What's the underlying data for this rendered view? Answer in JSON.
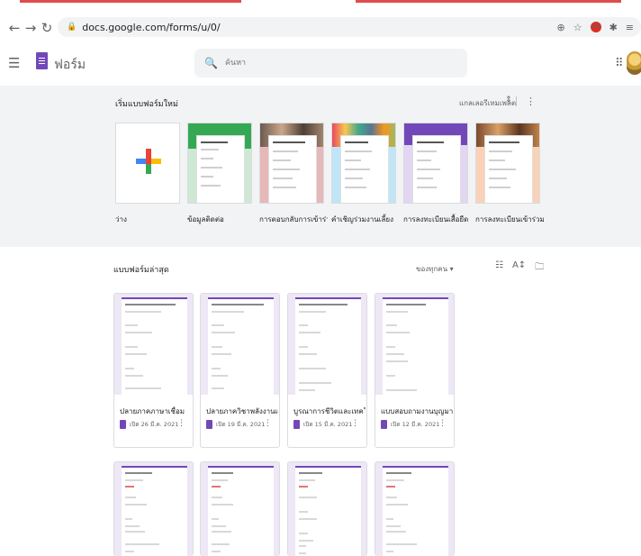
{
  "browser": {
    "url": "docs.google.com/forms/u/0/",
    "icons": [
      "back-icon",
      "forward-icon",
      "reload-icon",
      "lock-icon",
      "zoom-icon",
      "star-icon",
      "adblock-icon",
      "extensions-icon",
      "reading-list-icon"
    ]
  },
  "app": {
    "title": "ฟอร์ม",
    "search_placeholder": "ค้นหา"
  },
  "templates": {
    "heading": "เริ่มแบบฟอร์มใหม่",
    "gallery_label": "แกลเลอรีเทมเพลต",
    "items": [
      {
        "label": "ว่าง",
        "color": "#ffffff"
      },
      {
        "label": "ข้อมูลติดต่อ",
        "color": "#34a853"
      },
      {
        "label": "การตอบกลับการเข้าร่วมกิจ...",
        "color": "#e6b8b8"
      },
      {
        "label": "คำเชิญร่วมงานเลี้ยง",
        "color": "#8bd0f0"
      },
      {
        "label": "การลงทะเบียนเสื้อยืด",
        "color": "#7248b9"
      },
      {
        "label": "การลงทะเบียนเข้าร่วมกิจก...",
        "color": "#f4b183"
      }
    ]
  },
  "recent": {
    "heading": "แบบฟอร์มล่าสุด",
    "owner_filter": "ของทุกคน ▾",
    "docs": [
      {
        "name": "ปลายภาคภาษาเชื่อม",
        "opened": "เปิด 26 มี.ค. 2021"
      },
      {
        "name": "ปลายภาควิชาพลังงานและสิ่ง...",
        "opened": "เปิด 19 มี.ค. 2021"
      },
      {
        "name": "บูรณาการชีวิตและเทคโนโลยี...",
        "opened": "เปิด 15 มี.ค. 2021"
      },
      {
        "name": "แบบสอบถามงานบุญมาการ",
        "opened": "เปิด 12 มี.ค. 2021"
      },
      {
        "name": "",
        "opened": ""
      },
      {
        "name": "",
        "opened": ""
      },
      {
        "name": "",
        "opened": ""
      },
      {
        "name": "",
        "opened": ""
      }
    ]
  }
}
